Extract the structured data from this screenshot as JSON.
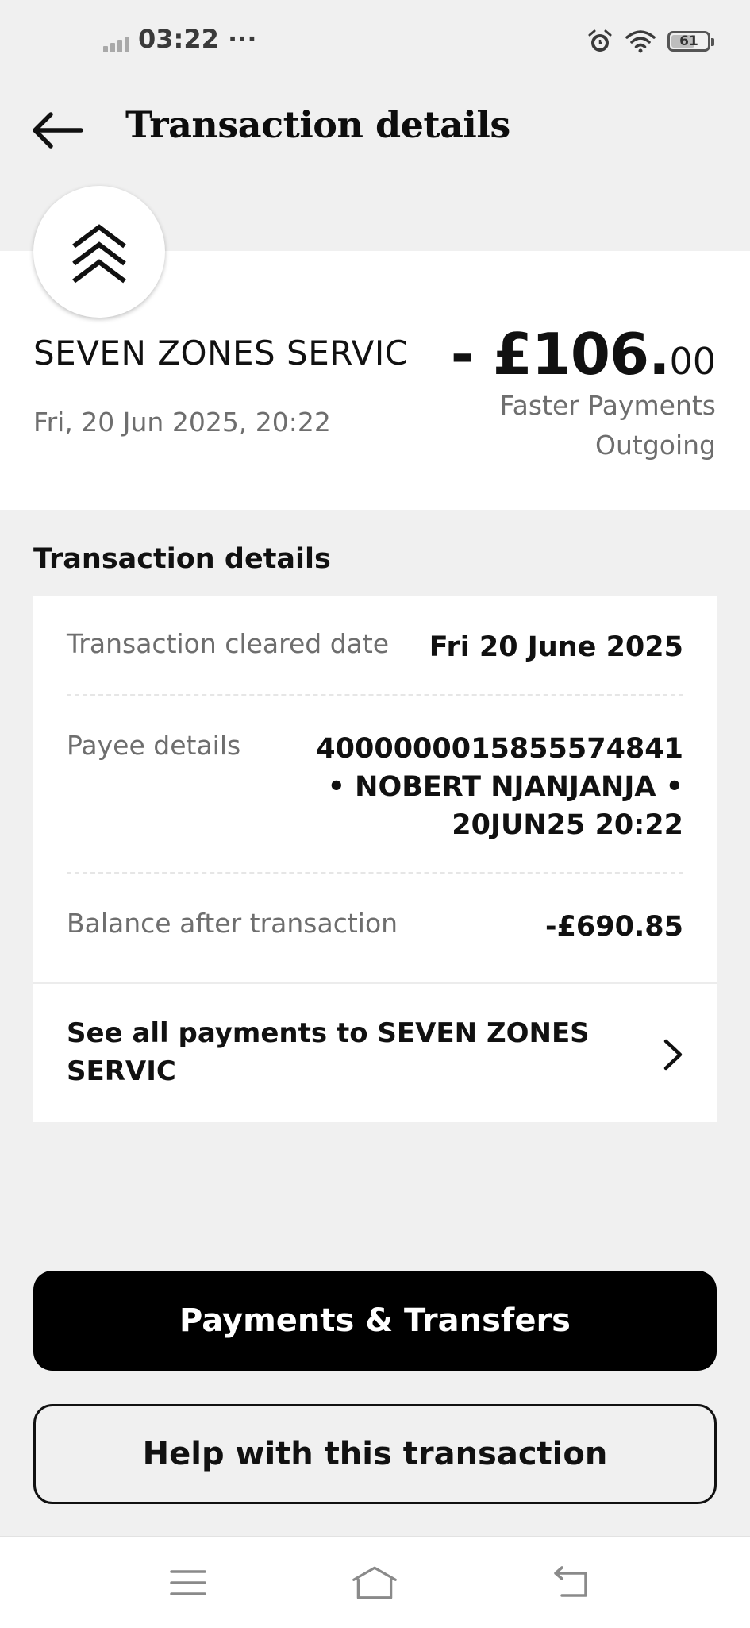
{
  "status_bar": {
    "time": "03:22",
    "dots": "···",
    "battery_level": "61"
  },
  "header": {
    "title": "Transaction details"
  },
  "merchant": {
    "name": "SEVEN ZONES SERVIC",
    "datetime": "Fri, 20 Jun 2025, 20:22",
    "amount_main": "- £106.",
    "amount_cents": "00",
    "payment_type_line1": "Faster Payments",
    "payment_type_line2": "Outgoing"
  },
  "details": {
    "section_title": "Transaction details",
    "cleared_label": "Transaction cleared date",
    "cleared_value": "Fri 20 June 2025",
    "payee_label": "Payee details",
    "payee_line1": "4000000015855574841",
    "payee_line2": "• NOBERT NJANJANJA •",
    "payee_line3": "20JUN25 20:22",
    "balance_label": "Balance after transaction",
    "balance_value": "-£690.85",
    "see_all_label": "See all payments to SEVEN ZONES SERVIC"
  },
  "actions": {
    "payments_transfers_label": "Payments & Transfers",
    "help_label": "Help with this transaction"
  },
  "nav_icons": [
    "menu-icon",
    "home-icon",
    "back-nav-icon"
  ],
  "colors": {
    "background": "#f0f0f0",
    "card": "#ffffff",
    "primary_button": "#000000",
    "secondary_text": "#6e6e6e"
  }
}
